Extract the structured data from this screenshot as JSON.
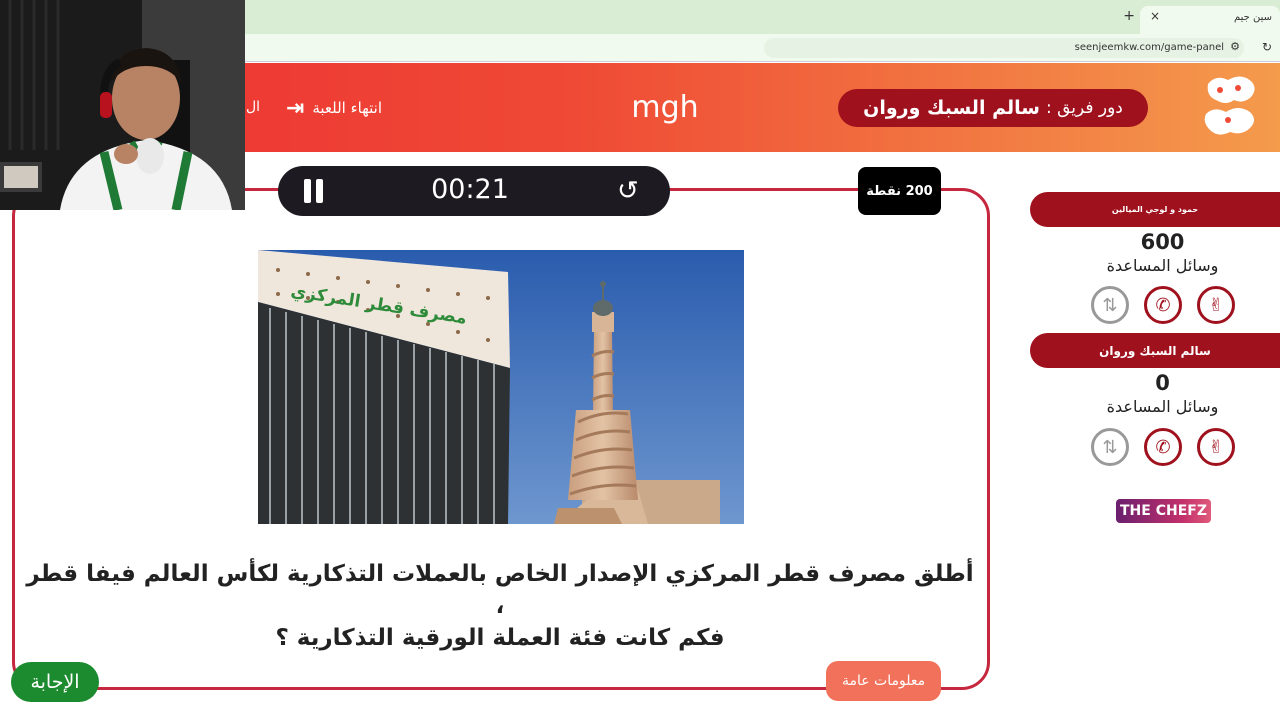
{
  "browser": {
    "tab_title": "سين جيم",
    "tab_close": "×",
    "new_tab": "+",
    "url": "seenjeemkw.com/game-panel"
  },
  "header": {
    "logo_text": "سين جيم",
    "turn_label": "دور فريق :",
    "turn_team": "سالم السبك وروان",
    "game_name": "mgh",
    "end_game_label": "انتهاء اللعبة",
    "back_fragment": "ال"
  },
  "question_card": {
    "timer": "00:21",
    "points": "200 نقطة",
    "question_line1": "أطلق مصرف قطر المركزي الإصدار الخاص بالعملات التذكارية لكأس العالم فيفا قطر ،",
    "question_line2": "فكم كانت فئة العملة الورقية التذكارية ؟",
    "photo_sign": "مصرف قطر المركزي",
    "category": "معلومات عامة",
    "answer_button": "الإجابة"
  },
  "teams": [
    {
      "name": "حمود و لوجي الميالين",
      "score": "600",
      "aids_label": "وسائل المساعدة",
      "aids": [
        {
          "icon": "two-answers-icon",
          "used": false
        },
        {
          "icon": "phone-call-icon",
          "used": false
        },
        {
          "icon": "swap-question-icon",
          "used": true
        }
      ]
    },
    {
      "name": "سالم السبك وروان",
      "score": "0",
      "aids_label": "وسائل المساعدة",
      "aids": [
        {
          "icon": "two-answers-icon",
          "used": false
        },
        {
          "icon": "phone-call-icon",
          "used": false
        },
        {
          "icon": "swap-question-icon",
          "used": true
        }
      ]
    }
  ],
  "sponsor": "THE CHEFZ",
  "colors": {
    "brand_dark_red": "#a0111e",
    "header_red": "#ec2f34",
    "header_orange": "#f49b4c",
    "card_border": "#c4273e",
    "answer_green": "#1c8b2f",
    "category_orange": "#f2715b"
  }
}
